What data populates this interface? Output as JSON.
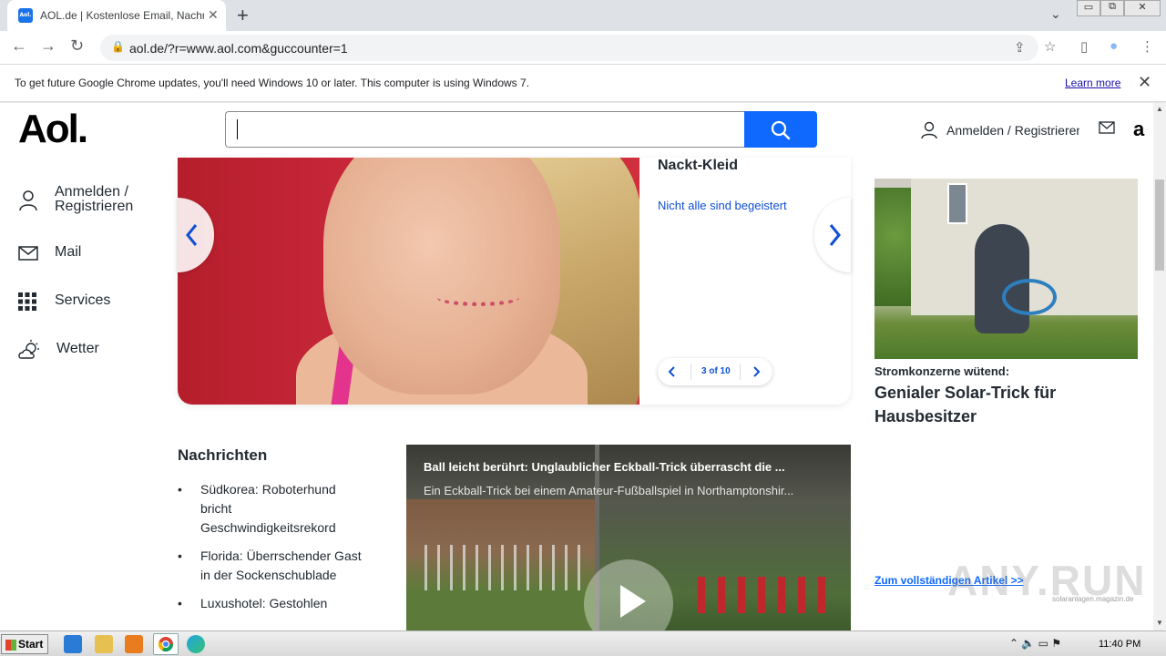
{
  "browser": {
    "tab_title": "AOL.de | Kostenlose Email, Nachrichten",
    "favicon_text": "Aol.",
    "tab_close": "✕",
    "new_tab": "+",
    "tab_search": "⌄",
    "window_controls": [
      "▭",
      "⧉",
      "✕"
    ],
    "url": "aol.de/?r=www.aol.com&guccounter=1",
    "nav": {
      "back": "←",
      "forward": "→",
      "reload": "↻"
    },
    "lock_icon": "🔒",
    "share_icon": "⇪",
    "star_icon": "☆",
    "sidepanel_icon": "▯",
    "profile_icon": "●",
    "menu_icon": "⋮"
  },
  "infobar": {
    "message": "To get future Google Chrome updates, you'll need Windows 10 or later. This computer is using Windows 7.",
    "link": "Learn more",
    "close": "✕"
  },
  "header": {
    "logo": "Aol.",
    "search_value": "",
    "login_label": "Anmelden / Registrieren",
    "amazon_label": "a"
  },
  "leftnav": {
    "items": [
      {
        "label": "Anmelden / Registrieren",
        "icon": "user-icon"
      },
      {
        "label": "Mail",
        "icon": "mail-icon"
      },
      {
        "label": "Services",
        "icon": "grid-icon"
      },
      {
        "label": "Wetter",
        "icon": "weather-icon"
      }
    ]
  },
  "carousel": {
    "title": "Nackt-Kleid",
    "link": "Nicht alle sind begeistert",
    "pager_text": "3 of 10",
    "prev": "‹",
    "next": "›"
  },
  "ad": {
    "kicker": "Stromkonzerne wütend:",
    "headline": "Genialer Solar-Trick für Hausbesitzer",
    "link": "Zum vollständigen Artikel >>",
    "watermark": "ANY.RUN",
    "source": "solaranlagen.magazin.de"
  },
  "news": {
    "heading": "Nachrichten",
    "items": [
      "Südkorea: Roboterhund bricht Geschwindigkeitsrekord",
      "Florida: Überrschender Gast in der Sockenschublade",
      "Luxushotel: Gestohlen"
    ]
  },
  "video": {
    "title": "Ball leicht berührt: Unglaublicher Eckball-Trick überrascht die ...",
    "description": "Ein Eckball-Trick bei einem Amateur-Fußballspiel in Northamptonshir..."
  },
  "taskbar": {
    "start": "Start",
    "tray_icons": "⌃ 🔈 ▭ ⚑",
    "clock": "11:40 PM"
  }
}
